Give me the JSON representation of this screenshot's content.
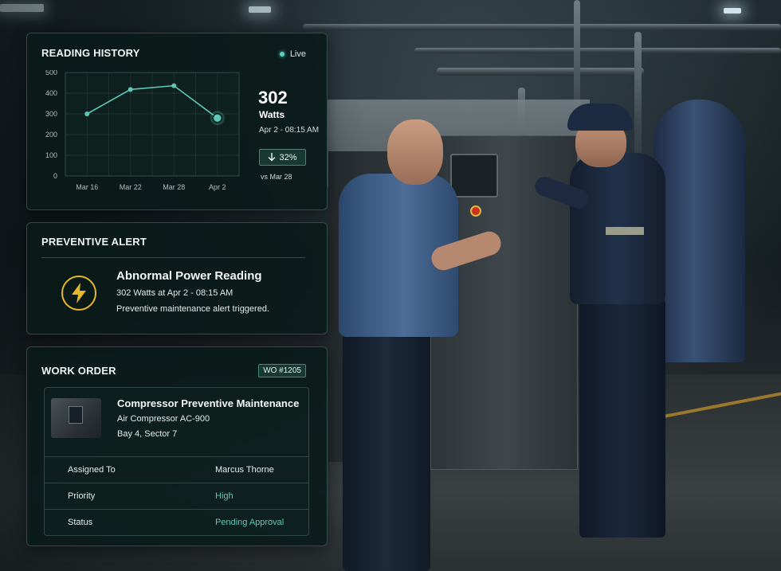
{
  "reading_history": {
    "title": "READING HISTORY",
    "live_label": "Live",
    "current_value": "302",
    "unit": "Watts",
    "timestamp": "Apr 2 - 08:15 AM",
    "change": "32%",
    "change_direction": "down",
    "change_ref": "vs Mar 28"
  },
  "chart_data": {
    "type": "line",
    "categories": [
      "Mar 16",
      "Mar 22",
      "Mar 28",
      "Apr 2"
    ],
    "series": [
      {
        "values": [
          300,
          418,
          436,
          280
        ]
      }
    ],
    "y_ticks": [
      0,
      100,
      200,
      300,
      400,
      500
    ],
    "ylim": [
      0,
      500
    ],
    "grid": true,
    "highlight_last_point": true,
    "line_color": "#5fc8b8"
  },
  "alert": {
    "title": "PREVENTIVE ALERT",
    "heading": "Abnormal Power Reading",
    "line1": "302 Watts at Apr 2 - 08:15 AM",
    "line2": "Preventive maintenance alert triggered.",
    "icon": "lightning-bolt-icon",
    "icon_color": "#e8b62a"
  },
  "work_order": {
    "title": "WORK ORDER",
    "number": "WO #1205",
    "asset_title": "Compressor Preventive Maintenance",
    "asset_name": "Air Compressor AC-900",
    "location": "Bay 4, Sector 7",
    "rows": [
      {
        "label": "Assigned To",
        "value": "Marcus Thorne"
      },
      {
        "label": "Priority",
        "value": "High"
      },
      {
        "label": "Status",
        "value": "Pending Approval"
      }
    ],
    "accent_color": "#5fc8b8"
  }
}
